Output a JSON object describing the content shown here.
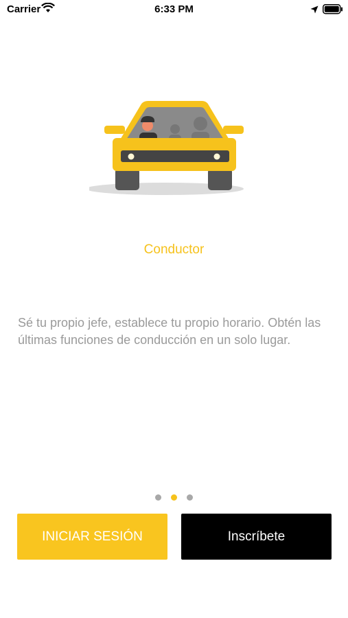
{
  "status_bar": {
    "carrier": "Carrier",
    "time": "6:33 PM",
    "icons": [
      "wifi-icon",
      "location-arrow-icon",
      "battery-icon"
    ]
  },
  "onboarding": {
    "illustration": "car-driver-illustration",
    "title": "Conductor",
    "description": "Sé tu propio jefe, establece tu propio horario. Obtén las últimas funciones de conducción en un solo lugar.",
    "page_indicator": {
      "total": 3,
      "current": 2
    }
  },
  "actions": {
    "login_label": "INICIAR SESIÓN",
    "signup_label": "Inscríbete"
  },
  "colors": {
    "accent": "#f6c21c",
    "signup_bg": "#000000",
    "description_text": "#9a9a9a"
  }
}
